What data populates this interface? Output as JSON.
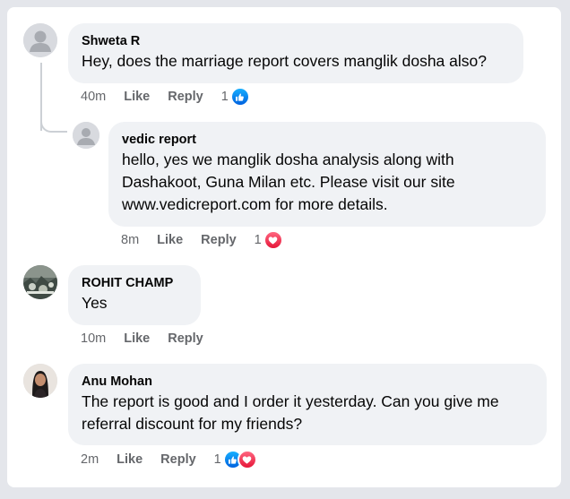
{
  "comments": [
    {
      "author": "Shweta R",
      "text": "Hey, does the marriage report covers manglik dosha also?",
      "time": "40m",
      "like_label": "Like",
      "reply_label": "Reply",
      "reaction_count": "1",
      "reactions": [
        "like-icon"
      ],
      "avatar": "default-avatar-icon"
    },
    {
      "author": "vedic report",
      "text_lines": [
        "hello, yes we manglik dosha analysis along with",
        "Dashakoot, Guna Milan etc. Please visit our site",
        "www.vedicreport.com for more details."
      ],
      "time": "8m",
      "like_label": "Like",
      "reply_label": "Reply",
      "reaction_count": "1",
      "reactions": [
        "love-icon"
      ],
      "avatar": "default-avatar-icon"
    },
    {
      "author": "ROHIT CHAMP",
      "text": "Yes",
      "time": "10m",
      "like_label": "Like",
      "reply_label": "Reply",
      "avatar": "photo-avatar"
    },
    {
      "author": "Anu Mohan",
      "text_lines": [
        "The report is good and I order it yesterday. Can you give me",
        "referral discount for my friends?"
      ],
      "time": "2m",
      "like_label": "Like",
      "reply_label": "Reply",
      "reaction_count": "1",
      "reactions": [
        "like-icon",
        "love-icon"
      ],
      "avatar": "photo-avatar"
    }
  ],
  "colors": {
    "bubble": "#f0f2f5",
    "meta_text": "#65676b",
    "like": "#1877f2",
    "love": "#f33e58"
  }
}
